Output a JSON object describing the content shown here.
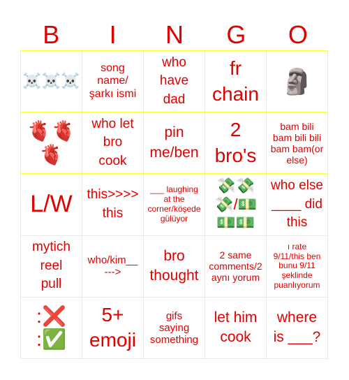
{
  "header": {
    "letters": [
      "B",
      "I",
      "N",
      "G",
      "O"
    ]
  },
  "colors": {
    "text": "#e00000",
    "grid": "#ffff33",
    "background": "#ffffff"
  },
  "cells": [
    {
      "text": "☠️☠️☠️",
      "icon": "skull-crossbones-icon"
    },
    {
      "text": "song\nname/\nşarkı ismi"
    },
    {
      "text": "who\nhave\ndad"
    },
    {
      "text": "fr\nchain"
    },
    {
      "text": "🗿",
      "icon": "moai-icon"
    },
    {
      "text": "🫀🫀\n🫀",
      "icon": "anatomical-heart-icon"
    },
    {
      "text": "who let\nbro\ncook"
    },
    {
      "text": "pin\nme/ben"
    },
    {
      "text": "2\nbro's"
    },
    {
      "text": "bam bili\nbam bili bili\nbam bam(or\nelse)"
    },
    {
      "text": "L/W"
    },
    {
      "text": "this>>>>\nthis"
    },
    {
      "text": "___ laughing\nat the\ncorner/köşede\ngülüyor"
    },
    {
      "text": "💸💸\n💸/💵\n💵💵",
      "icon": "money-icon"
    },
    {
      "text": "who else\n____ did\nthis"
    },
    {
      "text": "mytich\nreel\npull"
    },
    {
      "text": "who/kim__\n--->"
    },
    {
      "text": "bro\nthought"
    },
    {
      "text": "2 same\ncomments/2\naynı yorum"
    },
    {
      "text": "ı rate\n9/11/this ben\nbunu 9/11\nşeklinde\npuanlıyorum"
    },
    {
      "text": ":❌\n:✅",
      "icon": "cross-check-icon"
    },
    {
      "text": "5+\nemoji"
    },
    {
      "text": "gifs\nsaying\nsomething"
    },
    {
      "text": "let him\ncook"
    },
    {
      "text": "where\nis ___?"
    }
  ]
}
